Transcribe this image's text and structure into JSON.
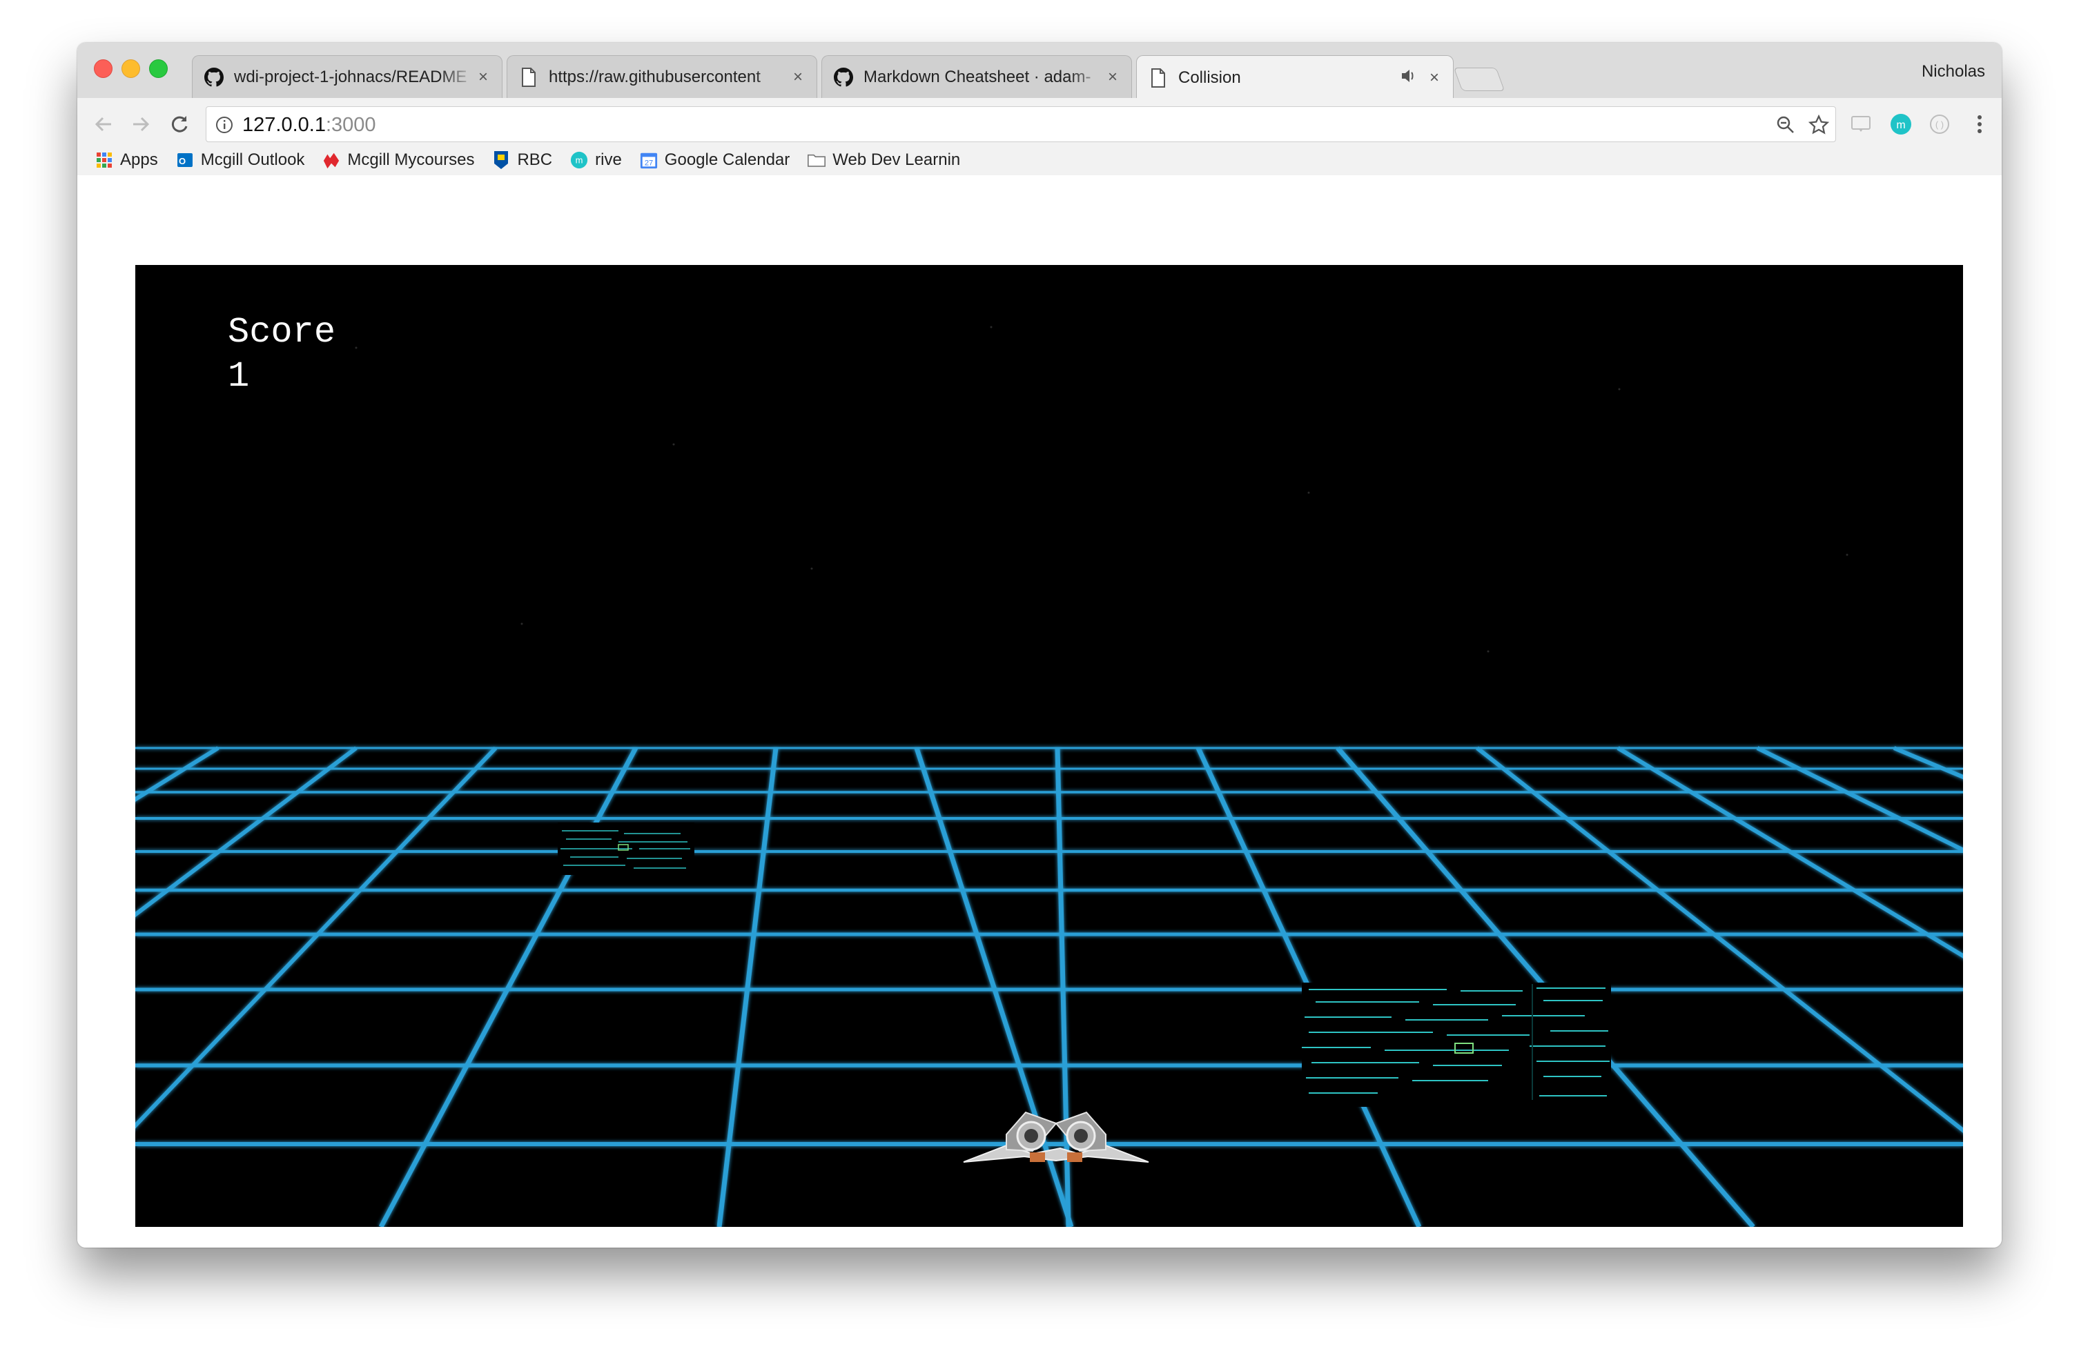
{
  "browser": {
    "tabs": [
      {
        "title": "wdi-project-1-johnacs/README",
        "icon": "github-icon"
      },
      {
        "title": "https://raw.githubusercontent",
        "icon": "page-icon"
      },
      {
        "title": "Markdown Cheatsheet · adam-",
        "icon": "github-icon"
      },
      {
        "title": "Collision",
        "icon": "page-icon",
        "active": true,
        "audio": true
      }
    ],
    "profile": "Nicholas",
    "url_host": "127.0.0.1",
    "url_port": ":3000",
    "bookmarks": [
      {
        "label": "Apps",
        "icon": "apps-grid-icon"
      },
      {
        "label": "Mcgill Outlook",
        "icon": "outlook-icon"
      },
      {
        "label": "Mcgill Mycourses",
        "icon": "mcgill-icon"
      },
      {
        "label": "RBC",
        "icon": "rbc-icon"
      },
      {
        "label": "rive",
        "icon": "rive-icon"
      },
      {
        "label": "Google Calendar",
        "icon": "calendar-icon"
      },
      {
        "label": "Web Dev Learnin",
        "icon": "folder-icon"
      }
    ],
    "colors": {
      "accent_grid": "#2a9fd6",
      "circuit": "#2ec4c4"
    }
  },
  "game": {
    "score_label": "Score",
    "score_value": "1"
  }
}
